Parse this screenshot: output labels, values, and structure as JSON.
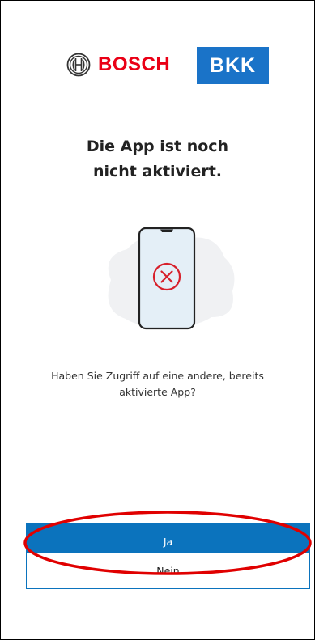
{
  "header": {
    "bosch_word": "BOSCH",
    "bkk_word": "BKK",
    "bosch_mark_icon": "bosch-armature-icon",
    "colors": {
      "bosch_red": "#ea0016",
      "bkk_blue": "#1a73c8"
    }
  },
  "main": {
    "title_line1": "Die App ist noch",
    "title_line2": "nicht aktiviert.",
    "illustration_icon": "phone-error-icon",
    "question_line1": "Haben Sie Zugriff auf eine andere, bereits",
    "question_line2": "aktivierte App?"
  },
  "actions": {
    "yes_label": "Ja",
    "no_label": "Nein",
    "primary_color": "#0b73bd"
  },
  "annotation": {
    "highlight_color": "#e00000",
    "highlight_target": "yes-button"
  }
}
